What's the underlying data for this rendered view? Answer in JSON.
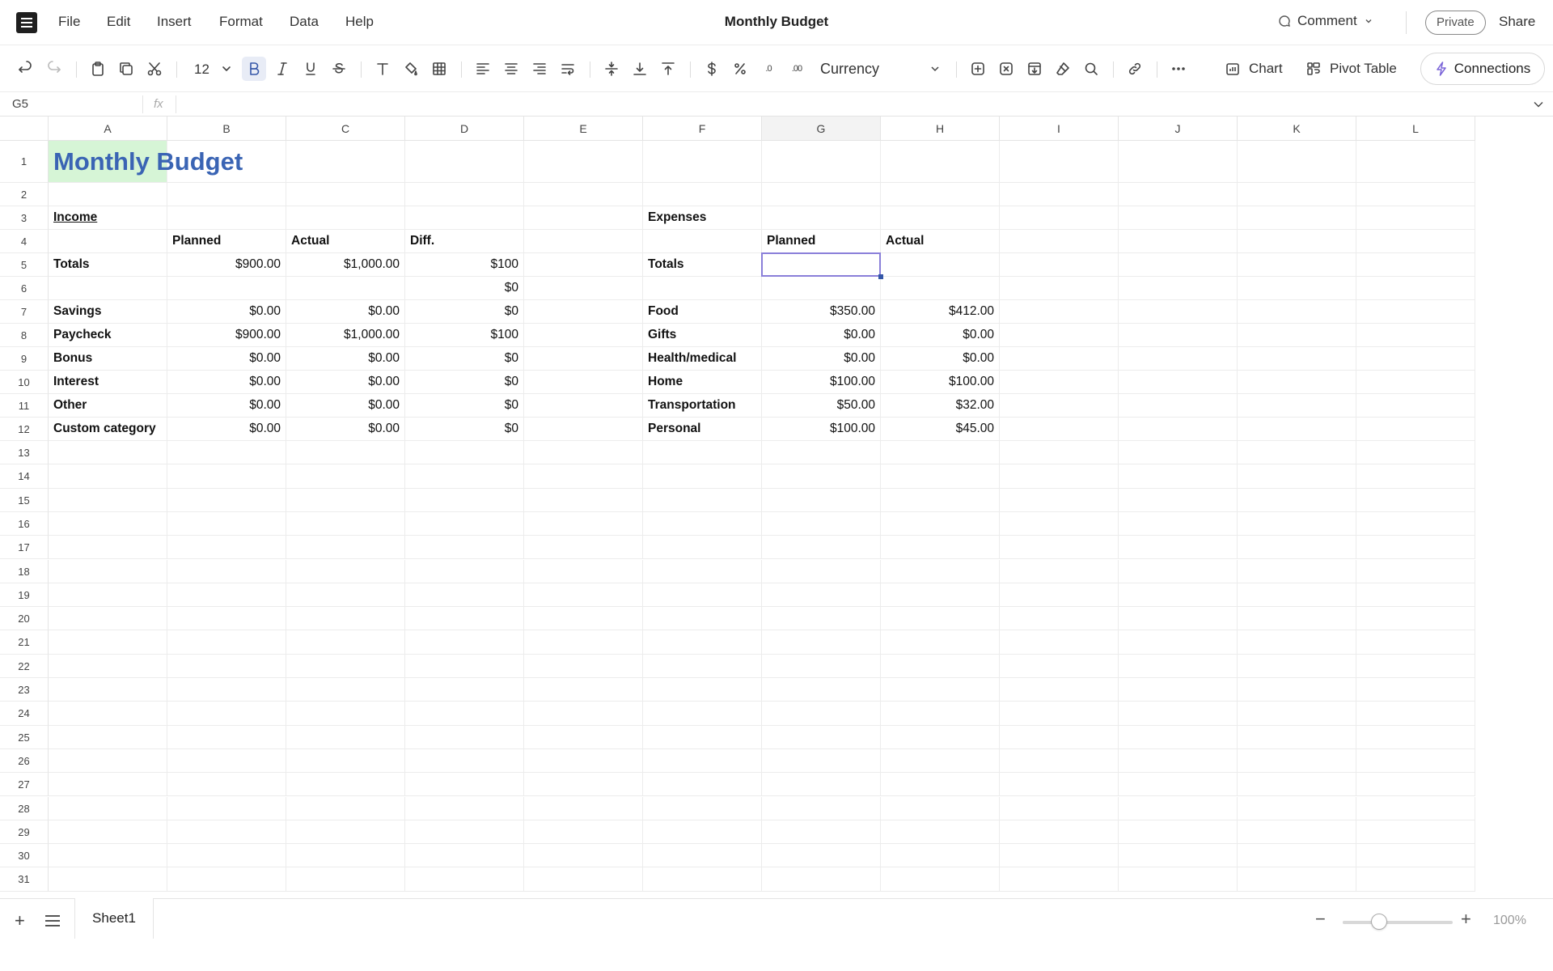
{
  "app": {
    "doc_title": "Monthly Budget",
    "menu": [
      "File",
      "Edit",
      "Insert",
      "Format",
      "Data",
      "Help"
    ],
    "comment_label": "Comment",
    "private_label": "Private",
    "share_label": "Share"
  },
  "toolbar": {
    "font_size": "12",
    "number_format": "Currency",
    "chart_label": "Chart",
    "pivot_label": "Pivot Table",
    "connections_label": "Connections",
    "decrease_decimals_glyph": ".0",
    "increase_decimals_glyph": ".00"
  },
  "formula_bar": {
    "cell_ref": "G5",
    "fx_label": "fx",
    "value": ""
  },
  "grid": {
    "columns": [
      "A",
      "B",
      "C",
      "D",
      "E",
      "F",
      "G",
      "H",
      "I",
      "J",
      "K",
      "L"
    ],
    "rows": [
      "1",
      "2",
      "3",
      "4",
      "5",
      "6",
      "7",
      "8",
      "9",
      "10",
      "11",
      "12",
      "13",
      "14",
      "15",
      "16",
      "17",
      "18",
      "19",
      "20",
      "21",
      "22",
      "23",
      "24",
      "25",
      "26",
      "27",
      "28",
      "29",
      "30",
      "31"
    ],
    "selected_cell": "G5",
    "cells": {
      "A1": "Monthly Budget",
      "A3": "Income",
      "F3": "Expenses",
      "B4": "Planned",
      "C4": "Actual",
      "D4": "Diff.",
      "G4": "Planned",
      "H4": "Actual",
      "A5": "Totals",
      "B5": "$900.00",
      "C5": "$1,000.00",
      "D5": "$100",
      "F5": "Totals",
      "D6": "$0",
      "A7": "Savings",
      "B7": "$0.00",
      "C7": "$0.00",
      "D7": "$0",
      "F7": "Food",
      "G7": "$350.00",
      "H7": "$412.00",
      "A8": "Paycheck",
      "B8": "$900.00",
      "C8": "$1,000.00",
      "D8": "$100",
      "F8": "Gifts",
      "G8": "$0.00",
      "H8": "$0.00",
      "A9": "Bonus",
      "B9": "$0.00",
      "C9": "$0.00",
      "D9": "$0",
      "F9": "Health/medical",
      "G9": "$0.00",
      "H9": "$0.00",
      "A10": "Interest",
      "B10": "$0.00",
      "C10": "$0.00",
      "D10": "$0",
      "F10": "Home",
      "G10": "$100.00",
      "H10": "$100.00",
      "A11": "Other",
      "B11": "$0.00",
      "C11": "$0.00",
      "D11": "$0",
      "F11": "Transportation",
      "G11": "$50.00",
      "H11": "$32.00",
      "A12": "Custom category",
      "B12": "$0.00",
      "C12": "$0.00",
      "D12": "$0",
      "F12": "Personal",
      "G12": "$100.00",
      "H12": "$45.00"
    }
  },
  "sheets": {
    "tabs": [
      "Sheet1"
    ],
    "active": "Sheet1"
  },
  "zoom": {
    "level_label": "100%",
    "slider_fraction": 0.33
  },
  "colors": {
    "title_text": "#3a64b4",
    "title_fill": "#d6f5d6",
    "selection_border": "#8a7fd9"
  }
}
